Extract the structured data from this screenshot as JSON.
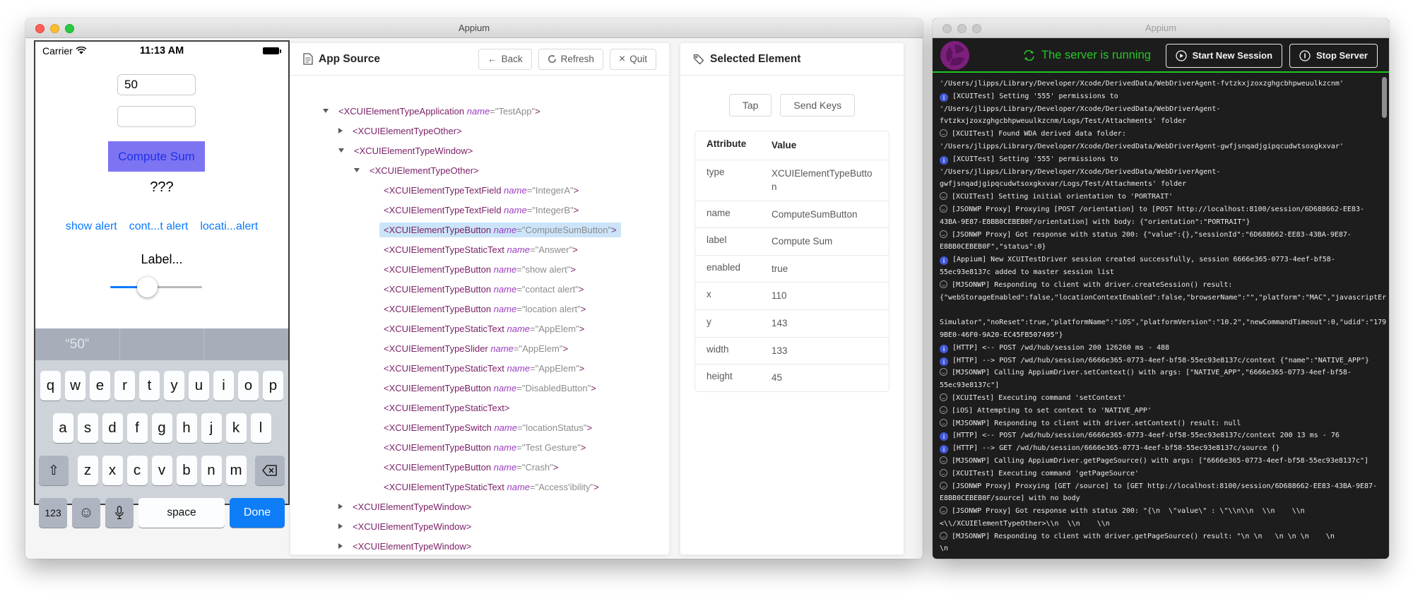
{
  "colors": {
    "ios_blue": "#0b7bff",
    "compute_bg": "#7d74f2",
    "compute_text": "#1e31e8",
    "selected_row_bg": "#cbe4f9",
    "status_green": "#25c825",
    "appium_purple": "#7d1f7d",
    "done_key_bg": "#0d7df8"
  },
  "inspector_window": {
    "title": "Appium",
    "phone": {
      "carrier": "Carrier",
      "time": "11:13 AM",
      "field_a": "50",
      "field_b": "",
      "compute_button": "Compute Sum",
      "answer": "???",
      "links": [
        "show alert",
        "cont...t alert",
        "locati...alert"
      ],
      "slider_label": "Label...",
      "keyboard": {
        "suggestion": "“50”",
        "row1": [
          "q",
          "w",
          "e",
          "r",
          "t",
          "y",
          "u",
          "i",
          "o",
          "p"
        ],
        "row2": [
          "a",
          "s",
          "d",
          "f",
          "g",
          "h",
          "j",
          "k",
          "l"
        ],
        "row3": [
          "z",
          "x",
          "c",
          "v",
          "b",
          "n",
          "m"
        ],
        "shift": "⇧",
        "num": "123",
        "emoji": "☺",
        "space": "space",
        "done": "Done"
      }
    },
    "app_source": {
      "title": "App Source",
      "back": "Back",
      "back_arrow": "←",
      "refresh": "Refresh",
      "quit": "Quit",
      "quit_x": "×",
      "tree": [
        {
          "i": 0,
          "c": "open",
          "t": "XCUIElementTypeApplication",
          "n": "TestApp"
        },
        {
          "i": 1,
          "c": "closed",
          "t": "XCUIElementTypeOther"
        },
        {
          "i": 1,
          "c": "open",
          "t": "XCUIElementTypeWindow"
        },
        {
          "i": 2,
          "c": "open",
          "t": "XCUIElementTypeOther"
        },
        {
          "i": 3,
          "t": "XCUIElementTypeTextField",
          "n": "IntegerA"
        },
        {
          "i": 3,
          "t": "XCUIElementTypeTextField",
          "n": "IntegerB"
        },
        {
          "i": 3,
          "t": "XCUIElementTypeButton",
          "n": "ComputeSumButton",
          "sel": true
        },
        {
          "i": 3,
          "t": "XCUIElementTypeStaticText",
          "n": "Answer"
        },
        {
          "i": 3,
          "t": "XCUIElementTypeButton",
          "n": "show alert"
        },
        {
          "i": 3,
          "t": "XCUIElementTypeButton",
          "n": "contact alert"
        },
        {
          "i": 3,
          "t": "XCUIElementTypeButton",
          "n": "location alert"
        },
        {
          "i": 3,
          "t": "XCUIElementTypeStaticText",
          "n": "AppElem"
        },
        {
          "i": 3,
          "t": "XCUIElementTypeSlider",
          "n": "AppElem"
        },
        {
          "i": 3,
          "t": "XCUIElementTypeStaticText",
          "n": "AppElem"
        },
        {
          "i": 3,
          "t": "XCUIElementTypeButton",
          "n": "DisabledButton"
        },
        {
          "i": 3,
          "t": "XCUIElementTypeStaticText"
        },
        {
          "i": 3,
          "t": "XCUIElementTypeSwitch",
          "n": "locationStatus"
        },
        {
          "i": 3,
          "t": "XCUIElementTypeButton",
          "n": "Test Gesture"
        },
        {
          "i": 3,
          "t": "XCUIElementTypeButton",
          "n": "Crash"
        },
        {
          "i": 3,
          "t": "XCUIElementTypeStaticText",
          "n": "Access'ibility"
        },
        {
          "i": 1,
          "c": "closed",
          "t": "XCUIElementTypeWindow"
        },
        {
          "i": 1,
          "c": "closed",
          "t": "XCUIElementTypeWindow"
        },
        {
          "i": 1,
          "c": "closed",
          "t": "XCUIElementTypeWindow"
        }
      ]
    },
    "selected_element": {
      "title": "Selected Element",
      "tap": "Tap",
      "send_keys": "Send Keys",
      "attr_header": "Attribute",
      "value_header": "Value",
      "rows": [
        [
          "type",
          "XCUIElementTypeButton"
        ],
        [
          "name",
          "ComputeSumButton"
        ],
        [
          "label",
          "Compute Sum"
        ],
        [
          "enabled",
          "true"
        ],
        [
          "x",
          "110"
        ],
        [
          "y",
          "143"
        ],
        [
          "width",
          "133"
        ],
        [
          "height",
          "45"
        ]
      ]
    }
  },
  "server_window": {
    "title": "Appium",
    "status": "The server is running",
    "start_button": "Start New Session",
    "stop_button": "Stop Server",
    "log": [
      {
        "t": "'/Users/jlipps/Library/Developer/Xcode/DerivedData/WebDriverAgent-fvtzkxjzoxzghgcbhpweuulkzcnm'"
      },
      {
        "ic": "info",
        "t": "[XCUITest] Setting '555' permissions to"
      },
      {
        "t": "'/Users/jlipps/Library/Developer/Xcode/DerivedData/WebDriverAgent-"
      },
      {
        "t": "fvtzkxjzoxzghgcbhpweuulkzcnm/Logs/Test/Attachments' folder"
      },
      {
        "ic": "debug",
        "t": "[XCUITest] Found WDA derived data folder:"
      },
      {
        "t": "'/Users/jlipps/Library/Developer/Xcode/DerivedData/WebDriverAgent-gwfjsnqadjgipqcudwtsoxgkxvar'"
      },
      {
        "ic": "info",
        "t": "[XCUITest] Setting '555' permissions to"
      },
      {
        "t": "'/Users/jlipps/Library/Developer/Xcode/DerivedData/WebDriverAgent-"
      },
      {
        "t": "gwfjsnqadjgipqcudwtsoxgkxvar/Logs/Test/Attachments' folder"
      },
      {
        "ic": "debug",
        "t": "[XCUITest] Setting initial orientation to 'PORTRAIT'"
      },
      {
        "ic": "debug",
        "t": "[JSONWP Proxy] Proxying [POST /orientation] to [POST http://localhost:8100/session/6D688662-EE83-"
      },
      {
        "t": "43BA-9E87-E8BB0CEBEB0F/orientation] with body: {\"orientation\":\"PORTRAIT\"}"
      },
      {
        "ic": "debug",
        "t": "[JSONWP Proxy] Got response with status 200: {\"value\":{},\"sessionId\":\"6D688662-EE83-43BA-9E87-"
      },
      {
        "t": "E8BB0CEBEB0F\",\"status\":0}"
      },
      {
        "ic": "info",
        "t": "[Appium] New XCUITestDriver session created successfully, session 6666e365-0773-4eef-bf58-"
      },
      {
        "t": "55ec93e8137c added to master session list"
      },
      {
        "ic": "debug",
        "t": "[MJSONWP] Responding to client with driver.createSession() result:"
      },
      {
        "t": "{\"webStorageEnabled\":false,\"locationContextEnabled\":false,\"browserName\":\"\",\"platform\":\"MAC\",\"javascriptEr"
      },
      {
        "t": ""
      },
      {
        "t": "Simulator\",\"noReset\":true,\"platformName\":\"iOS\",\"platformVersion\":\"10.2\",\"newCommandTimeout\":0,\"udid\":\"179"
      },
      {
        "t": "9BE0-46F0-9A20-EC45FB507495\"}"
      },
      {
        "ic": "info",
        "t": "[HTTP] <-- POST /wd/hub/session 200 126260 ms - 488"
      },
      {
        "ic": "info",
        "t": "[HTTP] --> POST /wd/hub/session/6666e365-0773-4eef-bf58-55ec93e8137c/context {\"name\":\"NATIVE_APP\"}"
      },
      {
        "ic": "debug",
        "t": "[MJSONWP] Calling AppiumDriver.setContext() with args: [\"NATIVE_APP\",\"6666e365-0773-4eef-bf58-"
      },
      {
        "t": "55ec93e8137c\"]"
      },
      {
        "ic": "debug",
        "t": "[XCUITest] Executing command 'setContext'"
      },
      {
        "ic": "debug",
        "t": "[iOS] Attempting to set context to 'NATIVE_APP'"
      },
      {
        "ic": "debug",
        "t": "[MJSONWP] Responding to client with driver.setContext() result: null"
      },
      {
        "ic": "info",
        "t": "[HTTP] <-- POST /wd/hub/session/6666e365-0773-4eef-bf58-55ec93e8137c/context 200 13 ms - 76"
      },
      {
        "ic": "info",
        "t": "[HTTP] --> GET /wd/hub/session/6666e365-0773-4eef-bf58-55ec93e8137c/source {}"
      },
      {
        "ic": "debug",
        "t": "[MJSONWP] Calling AppiumDriver.getPageSource() with args: [\"6666e365-0773-4eef-bf58-55ec93e8137c\"]"
      },
      {
        "ic": "debug",
        "t": "[XCUITest] Executing command 'getPageSource'"
      },
      {
        "ic": "debug",
        "t": "[JSONWP Proxy] Proxying [GET /source] to [GET http://localhost:8100/session/6D688662-EE83-43BA-9E87-"
      },
      {
        "t": "E8BB0CEBEB0F/source] with no body"
      },
      {
        "ic": "debug",
        "t": "[JSONWP Proxy] Got response with status 200: \"{\\n  \\\"value\\\" : \\\"\\\\n\\\\n  \\\\n    \\\\n"
      },
      {
        "t": "<\\\\/XCUIElementTypeOther>\\\\n  \\\\n    \\\\n"
      },
      {
        "ic": "debug",
        "t": "[MJSONWP] Responding to client with driver.getPageSource() result: \"\\n \\n   \\n \\n \\n    \\n"
      },
      {
        "t": "\\n"
      }
    ]
  }
}
